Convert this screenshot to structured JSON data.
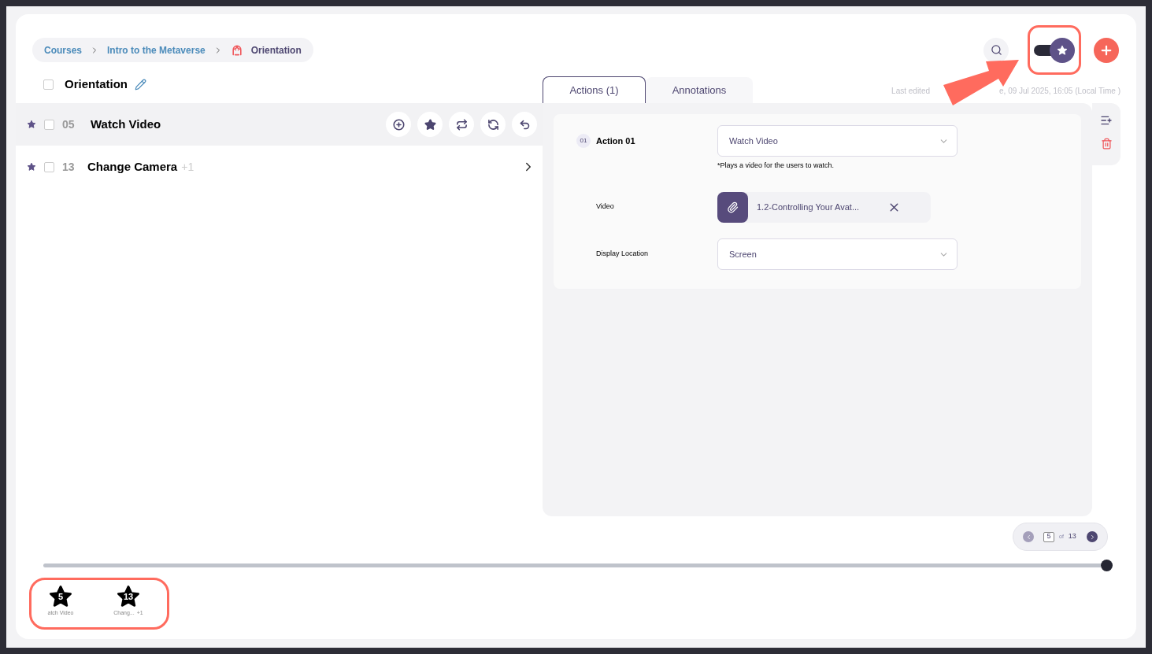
{
  "breadcrumb": [
    {
      "label": "Courses",
      "current": false
    },
    {
      "label": "Intro to the Metaverse",
      "current": false
    },
    {
      "label": "Orientation",
      "current": true
    }
  ],
  "toggle": {
    "on": true
  },
  "section": {
    "title": "Orientation",
    "checked": false
  },
  "steps": [
    {
      "number": "05",
      "title": "Watch Video",
      "selected": true,
      "checked": false
    },
    {
      "number": "13",
      "title": "Change Camera",
      "extra": "+1",
      "selected": false,
      "checked": false
    }
  ],
  "tabs": [
    {
      "label": "Actions (1)",
      "selected": true
    },
    {
      "label": "Annotations",
      "selected": false
    }
  ],
  "last_edited": {
    "label": "Last edited",
    "value": "e, 09 Jul 2025, 16:05 (Local Time )"
  },
  "action": {
    "badge": "01",
    "title": "Action 01",
    "fields": [
      {
        "kind": "select",
        "value": "Watch Video",
        "hint": "*Plays a video for the users to watch."
      },
      {
        "kind": "file",
        "label": "Video",
        "value": "1.2-Controlling Your Avat..."
      },
      {
        "kind": "select",
        "label": "Display Location",
        "value": "Screen"
      }
    ]
  },
  "pagination": {
    "page": "5",
    "of": "of",
    "total": "13",
    "prev_disabled": true,
    "next_disabled": false
  },
  "timeline": {
    "level": 1,
    "markers": [
      {
        "number": "5",
        "label": "atch Video"
      },
      {
        "number": "13",
        "label": "Chang...",
        "extra": "+1"
      }
    ]
  }
}
